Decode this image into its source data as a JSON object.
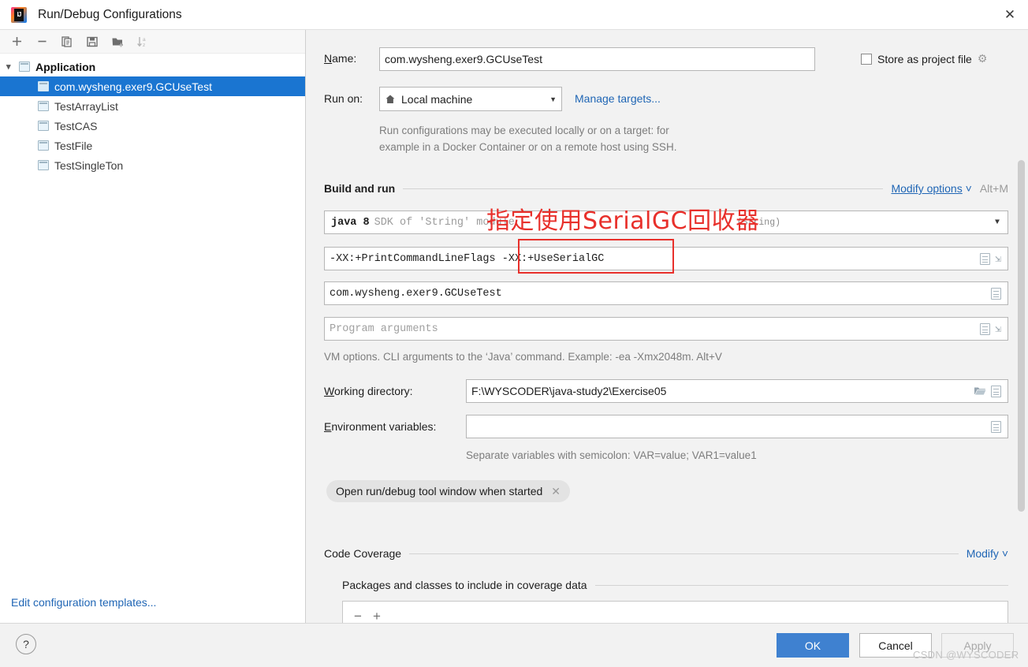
{
  "window": {
    "title": "Run/Debug Configurations",
    "app_icon": "intellij-idea-logo",
    "close_label": "✕"
  },
  "sidebar": {
    "toolbar": [
      {
        "name": "add-configuration",
        "icon": "plus-icon"
      },
      {
        "name": "remove-configuration",
        "icon": "minus-icon"
      },
      {
        "name": "copy-configuration",
        "icon": "copy-icon"
      },
      {
        "name": "save-configuration",
        "icon": "save-icon"
      },
      {
        "name": "move-to-folder",
        "icon": "folder-add-icon"
      },
      {
        "name": "sort-configurations",
        "icon": "sort-az-icon"
      }
    ],
    "tree": {
      "group_label": "Application",
      "items": [
        {
          "label": "com.wysheng.exer9.GCUseTest",
          "selected": true
        },
        {
          "label": "TestArrayList",
          "selected": false
        },
        {
          "label": "TestCAS",
          "selected": false
        },
        {
          "label": "TestFile",
          "selected": false
        },
        {
          "label": "TestSingleTon",
          "selected": false
        }
      ]
    },
    "edit_templates_link": "Edit configuration templates..."
  },
  "form": {
    "name_label": "Name:",
    "name_value": "com.wysheng.exer9.GCUseTest",
    "store_as_project_file": "Store as project file",
    "store_checked": false,
    "run_on_label": "Run on:",
    "run_on_value": "Local machine",
    "manage_targets_link": "Manage targets...",
    "run_on_hint_line1": "Run configurations may be executed locally or on a target: for",
    "run_on_hint_line2": "example in a Docker Container or on a remote host using SSH."
  },
  "build_and_run": {
    "section_title": "Build and run",
    "modify_options_link": "Modify options",
    "modify_options_shortcut": "Alt+M",
    "sdk_java": "java 8",
    "sdk_module": "SDK of 'String' module",
    "sdk_module_short": "(String)",
    "vm_options_value": "-XX:+PrintCommandLineFlags -XX:+UseSerialGC",
    "vm_options_part1": "-XX:+PrintCommandLineFlags",
    "vm_options_part2": "-XX:+UseSerialGC",
    "main_class_value": "com.wysheng.exer9.GCUseTest",
    "program_arguments_placeholder": "Program arguments",
    "vm_hint": "VM options. CLI arguments to the ‘Java’ command. Example: -ea -Xmx2048m. Alt+V",
    "working_directory_label": "Working directory:",
    "working_directory_value": "F:\\WYSCODER\\java-study2\\Exercise05",
    "environment_variables_label": "Environment variables:",
    "environment_variables_value": "",
    "environment_hint": "Separate variables with semicolon: VAR=value; VAR1=value1",
    "chip_label": "Open run/debug tool window when started",
    "chip_close": "✕"
  },
  "code_coverage": {
    "section_title": "Code Coverage",
    "modify_link": "Modify",
    "sub_title": "Packages and classes to include in coverage data",
    "remove_icon": "minus-icon",
    "add_icon": "plus-icon"
  },
  "annotation": {
    "text": "指定使用SerialGC回收器",
    "color": "#e8302b"
  },
  "footer": {
    "help_label": "?",
    "ok_label": "OK",
    "cancel_label": "Cancel",
    "apply_label": "Apply",
    "apply_disabled": true
  },
  "watermark": "CSDN @WYSCODER",
  "colors": {
    "accent_blue": "#2066b5",
    "selection_blue": "#1a75d1",
    "primary_button": "#3f81d0",
    "annotation_red": "#e8302b"
  }
}
